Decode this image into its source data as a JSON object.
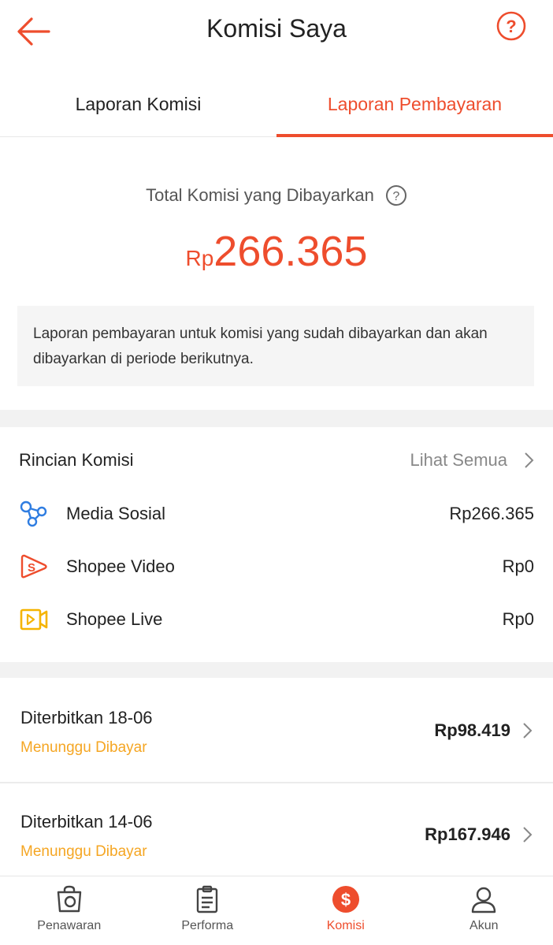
{
  "header": {
    "title": "Komisi Saya"
  },
  "tabs": [
    {
      "label": "Laporan Komisi",
      "active": false
    },
    {
      "label": "Laporan Pembayaran",
      "active": true
    }
  ],
  "total": {
    "label": "Total Komisi yang Dibayarkan",
    "currency": "Rp",
    "value": "266.365"
  },
  "info": {
    "text": "Laporan pembayaran untuk komisi yang sudah dibayarkan dan akan dibayarkan di periode berikutnya."
  },
  "rincian": {
    "title": "Rincian Komisi",
    "see_all": "Lihat Semua",
    "items": [
      {
        "icon": "social-media-icon",
        "label": "Media Sosial",
        "amount": "Rp266.365"
      },
      {
        "icon": "shopee-video-icon",
        "label": "Shopee Video",
        "amount": "Rp0"
      },
      {
        "icon": "shopee-live-icon",
        "label": "Shopee Live",
        "amount": "Rp0"
      }
    ]
  },
  "payouts": [
    {
      "title": "Diterbitkan 18-06",
      "status": "Menunggu Dibayar",
      "amount": "Rp98.419"
    },
    {
      "title": "Diterbitkan 14-06",
      "status": "Menunggu Dibayar",
      "amount": "Rp167.946"
    }
  ],
  "nav": [
    {
      "label": "Penawaran",
      "icon": "offer-bag-icon",
      "active": false
    },
    {
      "label": "Performa",
      "icon": "clipboard-icon",
      "active": false
    },
    {
      "label": "Komisi",
      "icon": "dollar-icon",
      "active": true
    },
    {
      "label": "Akun",
      "icon": "user-icon",
      "active": false
    }
  ],
  "colors": {
    "accent": "#ee4d2d",
    "pending": "#f5a623",
    "social": "#2f7de1",
    "live": "#f5b400"
  }
}
